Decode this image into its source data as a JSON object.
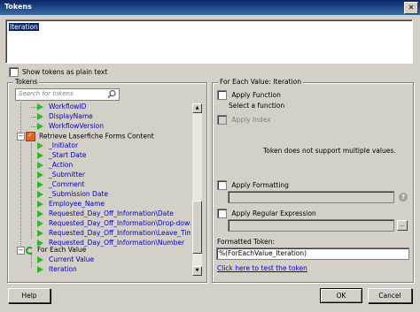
{
  "window": {
    "title": "Tokens",
    "close_glyph": "✕"
  },
  "token_input": {
    "value": "Iteration"
  },
  "show_plain": {
    "label": "Show tokens as plain text",
    "checked": false
  },
  "tokens_panel": {
    "title": "Tokens",
    "search_placeholder": "Search for tokens",
    "items": [
      {
        "label": "WorkflowID",
        "kind": "token"
      },
      {
        "label": "DisplayName",
        "kind": "token"
      },
      {
        "label": "WorkflowVersion",
        "kind": "token"
      },
      {
        "label": "Retrieve Laserfiche Forms Content",
        "kind": "activity"
      },
      {
        "label": "_Initiator",
        "kind": "token"
      },
      {
        "label": "_Start Date",
        "kind": "token"
      },
      {
        "label": "_Action",
        "kind": "token"
      },
      {
        "label": "_Submitter",
        "kind": "token"
      },
      {
        "label": "_Comment",
        "kind": "token"
      },
      {
        "label": "_Submission Date",
        "kind": "token"
      },
      {
        "label": "Employee_Name",
        "kind": "token"
      },
      {
        "label": "Requested_Day_Off_Information\\Date",
        "kind": "token"
      },
      {
        "label": "Requested_Day_Off_Information\\Drop-down",
        "kind": "token"
      },
      {
        "label": "Requested_Day_Off_Information\\Leave_Time",
        "kind": "token"
      },
      {
        "label": "Requested_Day_Off_Information\\Number",
        "kind": "token"
      },
      {
        "label": "For Each Value",
        "kind": "loop"
      },
      {
        "label": "Current Value",
        "kind": "token"
      },
      {
        "label": "Iteration",
        "kind": "token"
      }
    ]
  },
  "details_panel": {
    "title": "For Each Value: Iteration",
    "apply_function": {
      "label": "Apply Function",
      "checked": false
    },
    "select_function": "Select a function",
    "apply_index": {
      "label": "Apply Index",
      "checked": false,
      "disabled": true
    },
    "multi_msg": "Token does not support multiple values.",
    "apply_formatting": {
      "label": "Apply Formatting",
      "checked": false
    },
    "help_glyph": "?",
    "apply_regex": {
      "label": "Apply Regular Expression",
      "checked": false
    },
    "dots_glyph": "...",
    "formatted_label": "Formatted Token:",
    "formatted_value": "%(ForEachValue_Iteration)",
    "test_link": "Click here to test the token"
  },
  "buttons": {
    "help": "Help",
    "ok": "OK",
    "cancel": "Cancel"
  },
  "colors": {
    "token_text": "#0000cc",
    "title_bar": "#0a246a",
    "green_arrow": "#2db82d",
    "forms_icon": "#e8621a"
  }
}
